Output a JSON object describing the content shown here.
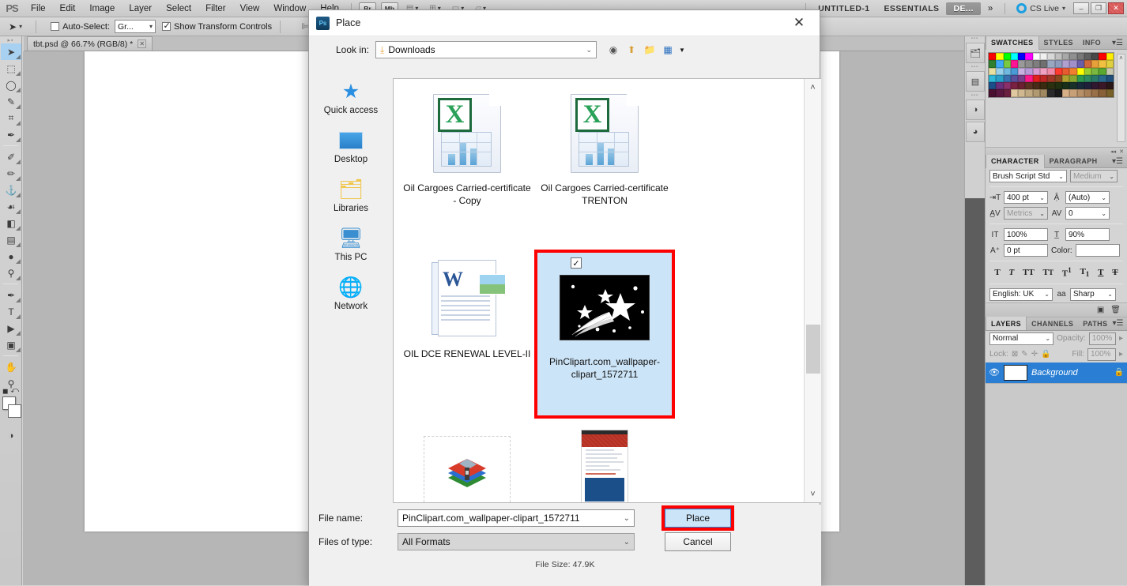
{
  "app": {
    "logo": "PS",
    "menus": [
      "File",
      "Edit",
      "Image",
      "Layer",
      "Select",
      "Filter",
      "View",
      "Window",
      "Help"
    ],
    "quick_buttons": [
      {
        "name": "bridge-button",
        "label": "Br"
      },
      {
        "name": "mini-bridge-button",
        "label": "Mb"
      }
    ],
    "view_dropdowns": [
      "ruler-view",
      "guides-view",
      "screen-mode",
      "arrange-documents"
    ],
    "workspace_tabs": [
      {
        "label": "UNTITLED-1",
        "active": false
      },
      {
        "label": "ESSENTIALS",
        "active": false
      },
      {
        "label": "DE...",
        "active": true
      }
    ],
    "overflow": "»",
    "cs_live": "CS Live",
    "window_controls": {
      "minimize": "–",
      "restore": "❐",
      "close": "✕"
    }
  },
  "options_bar": {
    "tool_preset_label": "▶✚",
    "auto_select_label": "Auto-Select:",
    "auto_select_checked": false,
    "auto_select_value": "Gr...",
    "show_transform_label": "Show Transform Controls",
    "show_transform_checked": true,
    "align_icons": [
      "align-left-edges",
      "align-horizontal-centers",
      "align-right-edges",
      "align-top-edges",
      "align-vertical-centers",
      "align-bottom-edges"
    ]
  },
  "document": {
    "tab_title": "tbt.psd @ 66.7% (RGB/8) *",
    "close_glyph": "✕"
  },
  "toolbar": {
    "tools": [
      {
        "name": "move-tool",
        "glyph": "➤",
        "selected": true
      },
      {
        "name": "marquee-tool",
        "glyph": "⬚",
        "selected": false
      },
      {
        "name": "lasso-tool",
        "glyph": "◯",
        "selected": false
      },
      {
        "name": "quick-selection-tool",
        "glyph": "✎",
        "selected": false
      },
      {
        "name": "crop-tool",
        "glyph": "⌗",
        "selected": false
      },
      {
        "name": "eyedropper-tool",
        "glyph": "✒",
        "selected": false
      },
      {
        "name": "spot-healing-tool",
        "glyph": "✐",
        "selected": false
      },
      {
        "name": "brush-tool",
        "glyph": "✏",
        "selected": false
      },
      {
        "name": "clone-stamp-tool",
        "glyph": "⚓",
        "selected": false
      },
      {
        "name": "history-brush-tool",
        "glyph": "☙",
        "selected": false
      },
      {
        "name": "eraser-tool",
        "glyph": "◧",
        "selected": false
      },
      {
        "name": "gradient-tool",
        "glyph": "▤",
        "selected": false
      },
      {
        "name": "blur-tool",
        "glyph": "●",
        "selected": false
      },
      {
        "name": "dodge-tool",
        "glyph": "⚲",
        "selected": false
      },
      {
        "name": "pen-tool",
        "glyph": "✒",
        "selected": false
      },
      {
        "name": "type-tool",
        "glyph": "T",
        "selected": false
      },
      {
        "name": "path-selection-tool",
        "glyph": "▶",
        "selected": false
      },
      {
        "name": "rectangle-tool",
        "glyph": "■",
        "selected": false
      },
      {
        "name": "hand-tool",
        "glyph": "✋",
        "selected": false
      },
      {
        "name": "zoom-tool",
        "glyph": "⚲",
        "selected": false
      }
    ],
    "foreground_color": "#ffffff",
    "background_color": "#ffffff",
    "quick_mask_glyph": "◑"
  },
  "rail": {
    "buttons": [
      {
        "name": "history-panel-icon",
        "glyph": "☰"
      },
      {
        "name": "actions-panel-icon",
        "glyph": "▤"
      },
      {
        "name": "adjustments-panel-icon",
        "glyph": "◑"
      },
      {
        "name": "masks-panel-icon",
        "glyph": "◕"
      }
    ]
  },
  "panels": {
    "swatches": {
      "tabs": [
        "SWATCHES",
        "STYLES",
        "INFO"
      ],
      "active_tab": "SWATCHES",
      "colors": [
        "#ff0000",
        "#ffff00",
        "#00ff00",
        "#00ffff",
        "#0000ff",
        "#ff00ff",
        "#ffffff",
        "#f0f0f0",
        "#d8d8d8",
        "#c0c0c0",
        "#a8a8a8",
        "#909090",
        "#787878",
        "#606060",
        "#484848",
        "#ff0000",
        "#ffee00",
        "#2f7f2f",
        "#3fa9f5",
        "#7ac943",
        "#ff1493",
        "#9a9a9a",
        "#8c8c8c",
        "#7e7e7e",
        "#707070",
        "#9aa7c0",
        "#8f9cbb",
        "#b0a0d0",
        "#a08fc8",
        "#6b5ea8",
        "#d06a3a",
        "#e8a13a",
        "#f0c040",
        "#e0d040",
        "#e8e0a0",
        "#9ad0e8",
        "#6fb8e0",
        "#4a9ad8",
        "#c8b0e0",
        "#b89ad8",
        "#d89ad0",
        "#f0a0c0",
        "#ef8aa8",
        "#ff3b2f",
        "#e85a30",
        "#f08030",
        "#ffff00",
        "#9acd32",
        "#7ab840",
        "#5aa830",
        "#c8c8b0",
        "#2fb8d8",
        "#2a9fc8",
        "#3a6fb0",
        "#5a4f9a",
        "#7a3f8a",
        "#ff1a8c",
        "#e02020",
        "#c02828",
        "#a03828",
        "#8a4820",
        "#b0a030",
        "#8aa830",
        "#2f9a4f",
        "#2f8a5f",
        "#2a7a6a",
        "#2a6a8a",
        "#1f4f7a",
        "#1b4f8a",
        "#6a2f7a",
        "#8a2f6a",
        "#7a2040",
        "#6a2030",
        "#5a3020",
        "#4a2a18",
        "#3a2a10",
        "#2a3010",
        "#203010",
        "#18301a",
        "#18302a",
        "#182a3a",
        "#20203a",
        "#301830",
        "#3a1828",
        "#2a1818",
        "#4a1030",
        "#5a1840",
        "#6a2040",
        "#e0c8a0",
        "#d0b890",
        "#c0a880",
        "#b09870",
        "#a08860",
        "#2a2a2a",
        "#1a1a1a",
        "#d8b088",
        "#c8a078",
        "#b89068",
        "#a88058",
        "#987048",
        "#886038",
        "#786028"
      ]
    },
    "character": {
      "tabs": [
        "CHARACTER",
        "PARAGRAPH"
      ],
      "active_tab": "CHARACTER",
      "font_family": "Brush Script Std",
      "font_style": "Medium",
      "font_size": "400 pt",
      "leading": "(Auto)",
      "kerning": "Metrics",
      "tracking": "0",
      "vertical_scale": "100%",
      "horizontal_scale": "90%",
      "baseline_shift": "0 pt",
      "color_label": "Color:",
      "color_value": "#ffffff",
      "style_buttons": [
        "T",
        "T",
        "TT",
        "Tt",
        "T¹",
        "T₁",
        "T",
        "T"
      ],
      "language": "English: UK",
      "antialias": "Sharp",
      "antialias_icon": "aa"
    },
    "layers": {
      "tabs": [
        "LAYERS",
        "CHANNELS",
        "PATHS"
      ],
      "active_tab": "LAYERS",
      "blend_mode": "Normal",
      "opacity_label": "Opacity:",
      "opacity_value": "100%",
      "lock_label": "Lock:",
      "lock_icons": [
        "lock-transparent-icon",
        "lock-image-icon",
        "lock-position-icon",
        "lock-all-icon"
      ],
      "fill_label": "Fill:",
      "fill_value": "100%",
      "items": [
        {
          "name": "Background",
          "visible": true,
          "locked": true,
          "selected": true
        }
      ]
    }
  },
  "dialog": {
    "title": "Place",
    "close_glyph": "✕",
    "lookin_label": "Look in:",
    "lookin_value": "Downloads",
    "nav_icons": [
      "back-icon",
      "up-one-level-icon",
      "create-new-folder-icon",
      "view-menu-icon"
    ],
    "places": [
      {
        "label": "Quick access",
        "icon": "quick-access-star-icon"
      },
      {
        "label": "Desktop",
        "icon": "desktop-icon"
      },
      {
        "label": "Libraries",
        "icon": "libraries-folder-icon"
      },
      {
        "label": "This PC",
        "icon": "this-pc-icon"
      },
      {
        "label": "Network",
        "icon": "network-globe-icon"
      }
    ],
    "files": [
      {
        "label": "Oil Cargoes Carried-certificate - Copy",
        "type": "excel",
        "selected": false,
        "checked": false
      },
      {
        "label": "Oil Cargoes Carried-certificate TRENTON",
        "type": "excel",
        "selected": false,
        "checked": false
      },
      {
        "label": "OIL DCE RENEWAL LEVEL-II",
        "type": "word",
        "selected": false,
        "checked": false
      },
      {
        "label": "PinClipart.com_wallpaper-clipart_1572711",
        "type": "image-star",
        "selected": true,
        "checked": true
      },
      {
        "label": "",
        "type": "rar",
        "selected": false,
        "checked": false
      },
      {
        "label": "",
        "type": "receipt",
        "selected": false,
        "checked": false
      }
    ],
    "filename_label": "File name:",
    "filename_value": "PinClipart.com_wallpaper-clipart_1572711",
    "filetype_label": "Files of type:",
    "filetype_value": "All Formats",
    "place_button": "Place",
    "cancel_button": "Cancel",
    "filesize_text": "File Size: 47.9K",
    "highlight_color": "#fd0000"
  }
}
